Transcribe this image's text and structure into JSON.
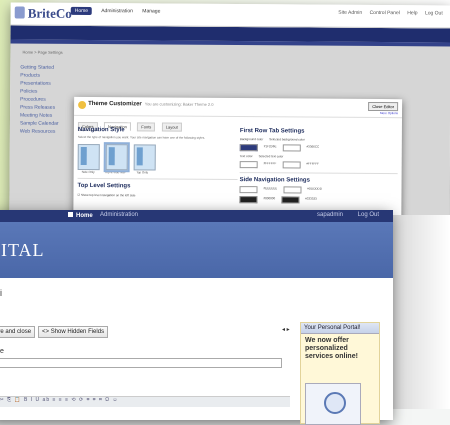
{
  "back_window": {
    "logo": "BriteCo",
    "nav": [
      "Home",
      "Administration",
      "Manage"
    ],
    "util": [
      "Site Admin",
      "Control Panel",
      "Help",
      "Log Out"
    ],
    "crumb": "Home > Page Settings",
    "left_links": [
      "Getting Started",
      "Products",
      "Presentations",
      "Policies",
      "Procedures",
      "Press Releases",
      "Meeting Notes",
      "Sample Calendar",
      "Web Resources"
    ]
  },
  "dialog": {
    "title": "Theme Customizer",
    "subtitle": "You are customizing: Baker Theme 2.0",
    "close_label": "Close Editor",
    "more_label": "More Options",
    "tabs": [
      "Colors",
      "Navigation",
      "Fonts",
      "Layout"
    ],
    "nav_style_heading": "Navigation Style",
    "nav_style_desc": "Select the type of navigation you want. Your site navigation can have one of the following styles.",
    "thumb_labels": [
      "Side Only",
      "Top & Side Nav",
      "Top Only"
    ],
    "top_level_heading": "Top Level Settings",
    "top_level_check": "Show top level navigation on the left side",
    "first_row_heading": "First Row Tab Settings",
    "side_nav_heading": "Side Navigation Settings",
    "labels": [
      "Background color",
      "Selected background color",
      "Text color",
      "Selected text color"
    ],
    "swatch_values": [
      "#1F2D6E",
      "#3366CC",
      "#FFFFFF",
      "#FFFFFF",
      "#EEEEEE",
      "#DDDDDD",
      "#000000",
      "#333333"
    ]
  },
  "front_window": {
    "nav_home": "Home",
    "nav_admin": "Administration",
    "nav_user": "sapadmin",
    "nav_logout": "Log Out",
    "banner_title": "PITAL",
    "page_letter": "i",
    "btn_save_close": "ave and close",
    "btn_show_hidden": "<> Show Hidden Fields",
    "field_letter": "e",
    "pager": "◂ ▸",
    "toolbar_glyphs": "[|]  ✂ ⎘ 📋  B I U ab  ≡ ≡ ≡  ⟲ ⟳  ⌗ ⌗ ⌗  Ω  ☺",
    "sidebox_header": "Your Personal Portal!",
    "sidebox_text": "We now offer personalized services online!"
  },
  "colors": {
    "navy": "#273775",
    "banner": "#4a67a8",
    "glow": "#eaf6cf",
    "sidebox_bg": "#fff8d8"
  }
}
